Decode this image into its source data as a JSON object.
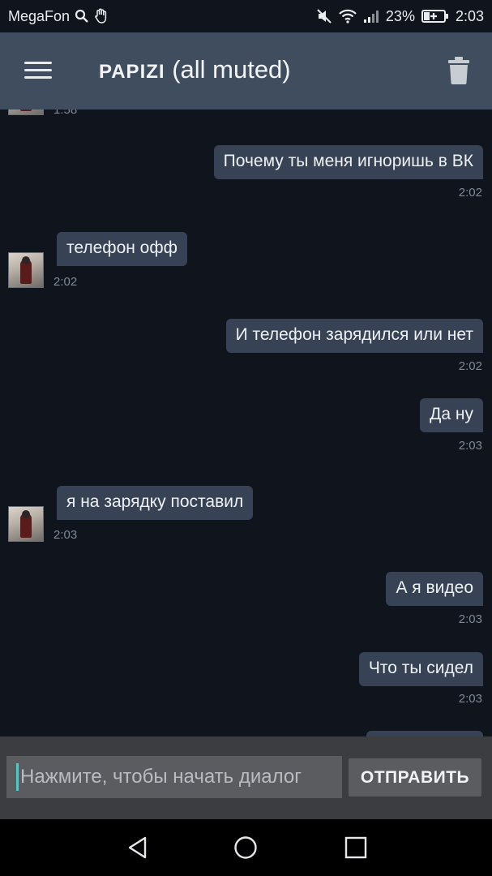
{
  "status_bar": {
    "carrier": "MegaFon",
    "battery": "23%",
    "time": "2:03",
    "icons": [
      "search-icon",
      "hand-icon",
      "mute-icon",
      "wifi-icon",
      "signal-icon",
      "battery-charging-icon"
    ]
  },
  "header": {
    "title_brand": "PAPIZI",
    "title_rest": "(all muted)",
    "menu_icon": "hamburger-menu-icon",
    "trash_icon": "trash-icon"
  },
  "chat": {
    "clipped_top_time": "1:58",
    "messages": [
      {
        "dir": "out",
        "text": "Почему ты меня игноришь в ВК",
        "time": "2:02"
      },
      {
        "dir": "in",
        "text": "телефон офф",
        "time": "2:02"
      },
      {
        "dir": "out",
        "text": "И телефон зарядился или нет",
        "time": "2:02"
      },
      {
        "dir": "out",
        "text": "Да ну",
        "time": "2:03"
      },
      {
        "dir": "in",
        "text": "я на зарядку поставил",
        "time": "2:03"
      },
      {
        "dir": "out",
        "text": "А я видео",
        "time": "2:03"
      },
      {
        "dir": "out",
        "text": "Что ты сидел",
        "time": "2:03"
      }
    ]
  },
  "composer": {
    "placeholder": "Нажмите, чтобы начать диалог",
    "send_label": "ОТПРАВИТЬ"
  },
  "navbar": {
    "icons": [
      "back-icon",
      "home-icon",
      "recents-icon"
    ]
  },
  "colors": {
    "header_bg": "#3f4d5e",
    "chat_bg": "#0f141d",
    "bubble_bg": "#374254",
    "input_bar_bg": "#3b3d40",
    "accent_caret": "#5cc3c0"
  }
}
